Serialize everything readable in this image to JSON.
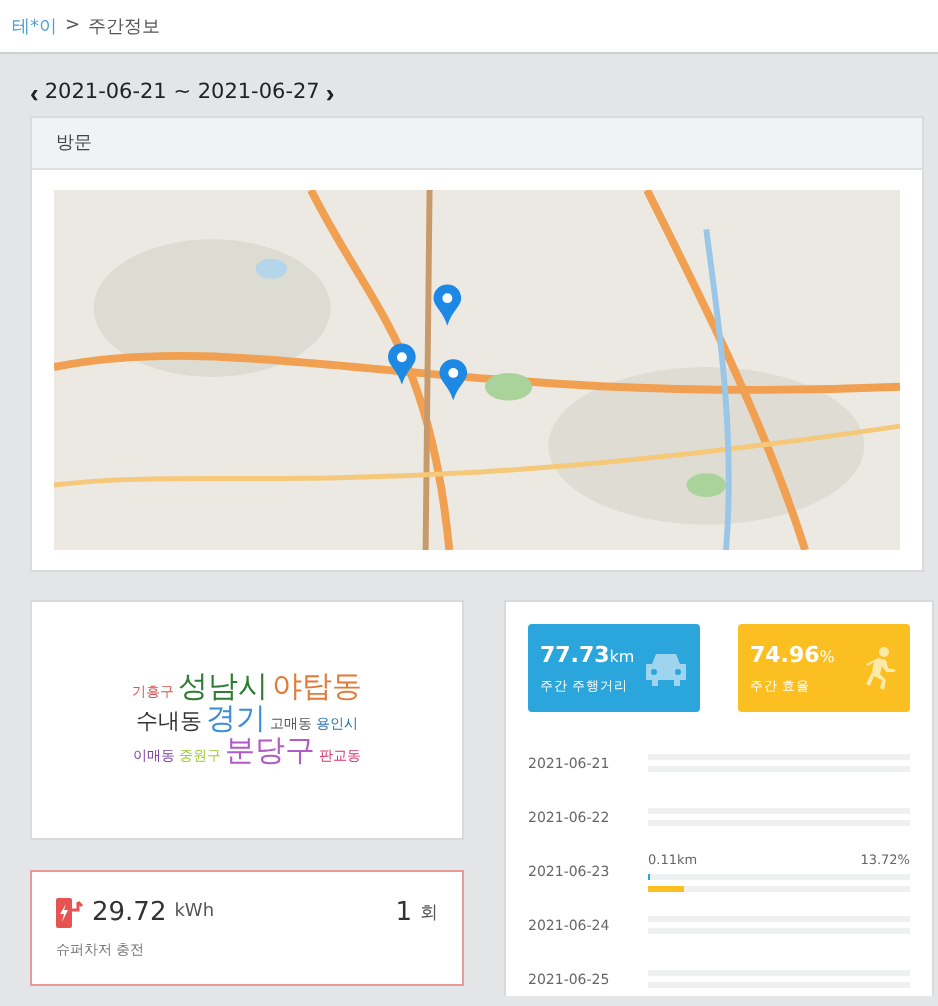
{
  "breadcrumb": {
    "link": "테*이",
    "separator": ">",
    "current": "주간정보"
  },
  "week": {
    "prev": "‹",
    "range": "2021-06-21 ~ 2021-06-27",
    "next": "›"
  },
  "visits": {
    "title": "방문"
  },
  "word_cloud": [
    {
      "text": "기흥구",
      "color": "#d9534f",
      "kind": "tiny"
    },
    {
      "text": "성남시",
      "color": "#2e7d32",
      "kind": "large"
    },
    {
      "text": "야탑동",
      "color": "#e07b39",
      "kind": "large"
    },
    {
      "text": "수내동",
      "color": "#333333",
      "kind": "medium"
    },
    {
      "text": "경기",
      "color": "#3b8fd6",
      "kind": "large"
    },
    {
      "text": "고매동",
      "color": "#555555",
      "kind": "tiny"
    },
    {
      "text": "용인시",
      "color": "#2a6fb0",
      "kind": "tiny"
    },
    {
      "text": "이매동",
      "color": "#7b3fa0",
      "kind": "tiny"
    },
    {
      "text": "중원구",
      "color": "#9acd32",
      "kind": "tiny"
    },
    {
      "text": "분당구",
      "color": "#b05cc8",
      "kind": "large"
    },
    {
      "text": "판교동",
      "color": "#d6336c",
      "kind": "tiny"
    }
  ],
  "charging": {
    "value": "29.72",
    "unit": "kWh",
    "label": "슈퍼차저 충전",
    "count": "1",
    "count_unit": "회"
  },
  "stats": [
    {
      "value": "77.73",
      "unit": "km",
      "label": "주간 주행거리",
      "kind": "distance",
      "color": "#2ba6dc"
    },
    {
      "value": "74.96",
      "unit": "%",
      "label": "주간 효율",
      "kind": "efficiency",
      "color": "#fbbf22"
    }
  ],
  "days": [
    {
      "date": "2021-06-21"
    },
    {
      "date": "2021-06-22"
    },
    {
      "date": "2021-06-23",
      "distance": "0.11km",
      "percent": "13.72%",
      "bars": [
        {
          "level": 0.005
        },
        {
          "level": 0.1372
        }
      ]
    },
    {
      "date": "2021-06-24"
    },
    {
      "date": "2021-06-25"
    }
  ]
}
